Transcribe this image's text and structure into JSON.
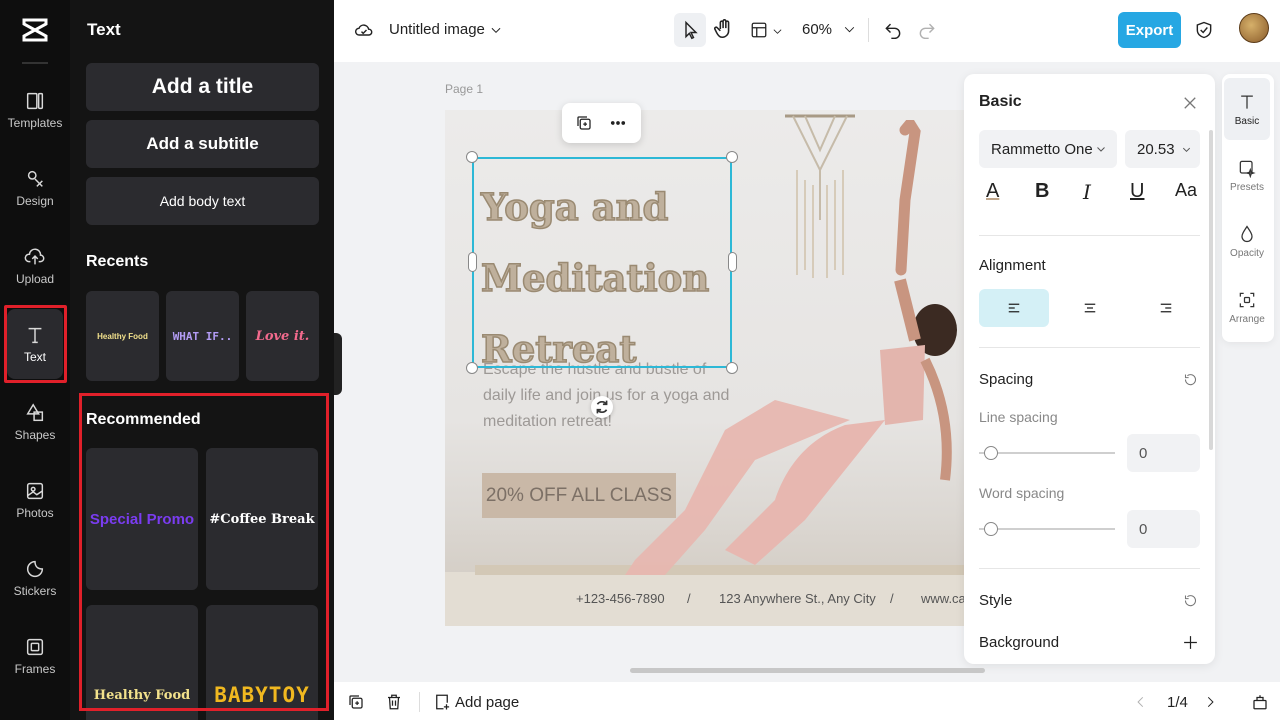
{
  "rail": {
    "items": [
      {
        "label": "Templates"
      },
      {
        "label": "Design"
      },
      {
        "label": "Upload"
      },
      {
        "label": "Text"
      },
      {
        "label": "Shapes"
      },
      {
        "label": "Photos"
      },
      {
        "label": "Stickers"
      },
      {
        "label": "Frames"
      }
    ],
    "active": "Text"
  },
  "text_panel": {
    "title": "Text",
    "add_title": "Add a title",
    "add_subtitle": "Add a subtitle",
    "add_body": "Add body text",
    "recents_title": "Recents",
    "recents": [
      "Healthy Food",
      "WHAT IF..",
      "Love it."
    ],
    "recommended_title": "Recommended",
    "recommended": [
      "Special Promo",
      "#Coffee Break",
      "Healthy Food",
      "BABYTOY"
    ]
  },
  "topbar": {
    "doc_title": "Untitled image",
    "zoom": "60%",
    "export_label": "Export"
  },
  "canvas": {
    "page_label": "Page 1",
    "title_lines": [
      "Yoga and",
      "Meditation",
      "Retreat"
    ],
    "body": "Escape the hustle and bustle of daily life and join us for a yoga and meditation retreat!",
    "promo": "20% OFF ALL CLASS",
    "phone": "+123-456-7890",
    "slash1": "/",
    "address": "123 Anywhere St., Any City",
    "slash2": "/",
    "website": "www.ca"
  },
  "props": {
    "title": "Basic",
    "font": "Rammetto One",
    "size": "20.53",
    "format_buttons": [
      "A",
      "B",
      "I",
      "U",
      "Aa"
    ],
    "alignment_title": "Alignment",
    "spacing_title": "Spacing",
    "line_spacing_label": "Line spacing",
    "line_spacing_value": "0",
    "word_spacing_label": "Word spacing",
    "word_spacing_value": "0",
    "style_title": "Style",
    "background_label": "Background"
  },
  "strip": {
    "items": [
      {
        "label": "Basic"
      },
      {
        "label": "Presets"
      },
      {
        "label": "Opacity"
      },
      {
        "label": "Arrange"
      }
    ]
  },
  "bottombar": {
    "add_page": "Add page",
    "page_indicator": "1/4"
  },
  "colors": {
    "accent": "#26a7e3",
    "highlight": "#e0202a",
    "selection": "#2db8d6"
  }
}
